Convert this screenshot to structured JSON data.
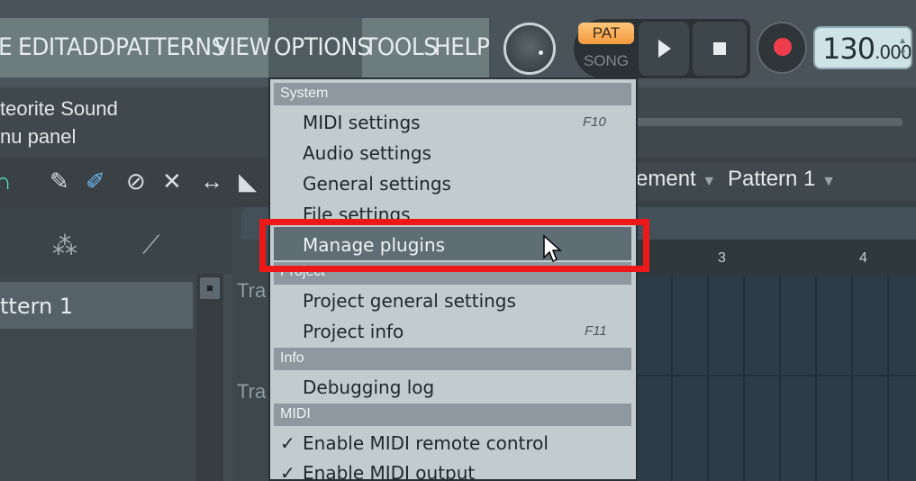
{
  "menubar": {
    "items": [
      "E",
      "EDIT",
      "ADD",
      "PATTERNS",
      "VIEW",
      "OPTIONS",
      "TOOLS",
      "HELP"
    ],
    "active": "OPTIONS"
  },
  "transport": {
    "pat_label": "PAT",
    "song_label": "SONG",
    "tempo_int": "130",
    "tempo_frac": ".000",
    "record_color": "#ef3c4c",
    "pat_color": "#f4993e"
  },
  "hint": {
    "line1": "teorite Sound",
    "line2": "nu panel"
  },
  "toolbar": {
    "arrangement": "ement",
    "pattern": "Pattern 1"
  },
  "left_panel": {
    "pattern_item": "ttern 1"
  },
  "playlist": {
    "track1": "Tra",
    "track2": "Tra",
    "ruler": [
      "3",
      "4"
    ]
  },
  "dropdown": {
    "system_header": "System",
    "system_items": [
      "MIDI settings",
      "Audio settings",
      "General settings",
      "File settings",
      "Manage plugins"
    ],
    "midi_settings_shortcut": "F10",
    "project_header": "Project",
    "project_items": [
      "Project general settings",
      "Project info"
    ],
    "project_info_shortcut": "F11",
    "info_header": "Info",
    "info_items": [
      "Debugging log"
    ],
    "midi_header": "MIDI",
    "midi_items": [
      "Enable MIDI remote control",
      "Enable MIDI output"
    ],
    "check": "✓"
  }
}
